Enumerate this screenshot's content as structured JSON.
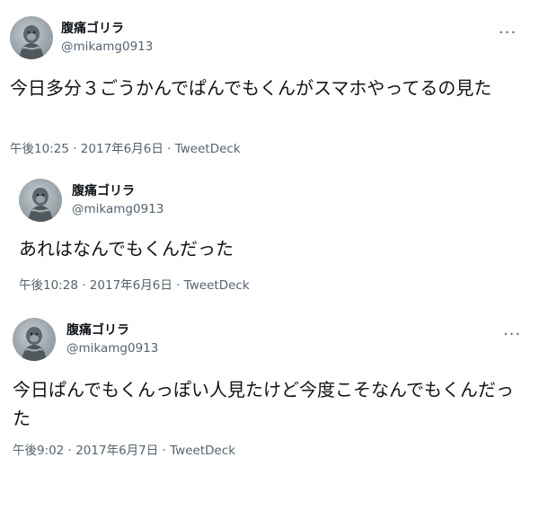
{
  "tweets": [
    {
      "name": "腹痛ゴリラ",
      "handle": "@mikamg0913",
      "avatar_icon": "gorilla-avatar",
      "more_icon": "more-dots-icon",
      "more_glyph": "···",
      "text": "今日多分３ごうかんでぱんでもくんがスマホやってるの見た",
      "time": "午後10:25",
      "date": "2017年6月6日",
      "separator": "·",
      "source": "TweetDeck"
    },
    {
      "name": "腹痛ゴリラ",
      "handle": "@mikamg0913",
      "avatar_icon": "gorilla-avatar",
      "text": "あれはなんでもくんだった",
      "time": "午後10:28",
      "date": "2017年6月6日",
      "separator": "·",
      "source": "TweetDeck"
    },
    {
      "name": "腹痛ゴリラ",
      "handle": "@mikamg0913",
      "avatar_icon": "gorilla-avatar",
      "more_icon": "more-dots-icon",
      "more_glyph": "···",
      "text": "今日ぱんでもくんっぽい人見たけど今度こそなんでもくんだった",
      "time": "午後9:02",
      "date": "2017年6月7日",
      "separator": "·",
      "source": "TweetDeck"
    }
  ]
}
